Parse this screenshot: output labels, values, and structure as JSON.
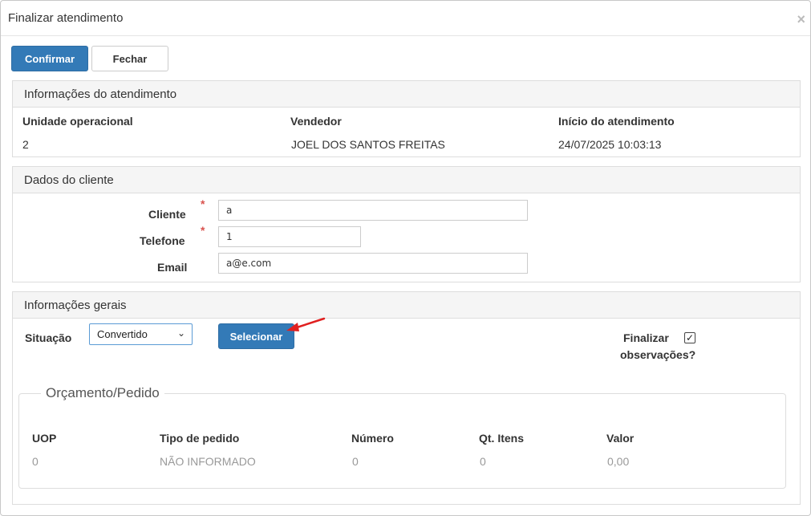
{
  "dialog": {
    "title": "Finalizar atendimento",
    "close": "×"
  },
  "toolbar": {
    "confirm_label": "Confirmar",
    "close_label": "Fechar"
  },
  "attendance": {
    "heading": "Informações do atendimento",
    "unit_label": "Unidade operacional",
    "unit_value": "2",
    "seller_label": "Vendedor",
    "seller_value": "JOEL DOS SANTOS FREITAS",
    "start_label": "Início do atendimento",
    "start_value": "24/07/2025 10:03:13"
  },
  "client": {
    "heading": "Dados do cliente",
    "name_label": "Cliente",
    "name_value": "a",
    "phone_label": "Telefone",
    "phone_value": "1",
    "email_label": "Email",
    "email_value": "a@e.com",
    "required_mark": "*"
  },
  "general": {
    "heading": "Informações gerais",
    "status_label": "Situação",
    "status_selected": "Convertido",
    "select_button": "Selecionar",
    "finalize_label_1": "Finalizar",
    "finalize_label_2": "observações?",
    "finalize_checked": true,
    "check_mark": "✓"
  },
  "order": {
    "legend": "Orçamento/Pedido",
    "columns": [
      "UOP",
      "Tipo de pedido",
      "Número",
      "Qt. Itens",
      "Valor"
    ],
    "row": [
      "0",
      "NÃO INFORMADO",
      "0",
      "0",
      "0,00"
    ]
  },
  "colors": {
    "primary": "#337ab7",
    "required": "#d9534f",
    "annotation_arrow": "#e02020"
  }
}
